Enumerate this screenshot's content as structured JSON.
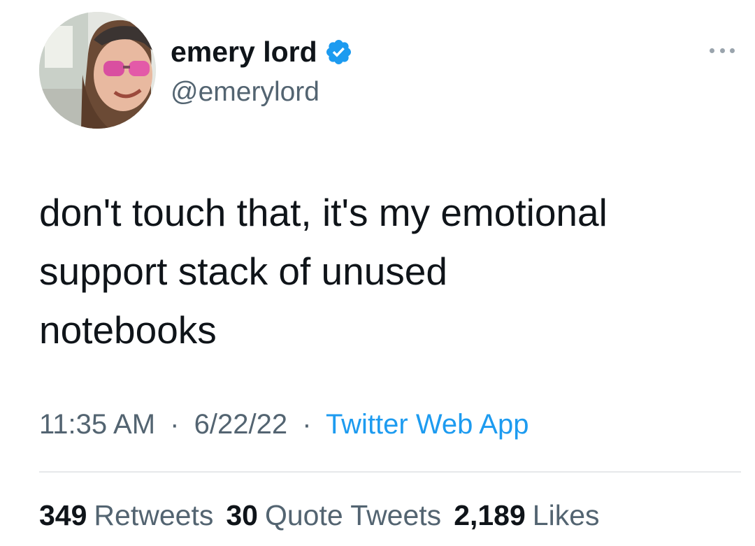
{
  "author": {
    "display_name": "emery lord",
    "handle": "@emerylord",
    "verified": true,
    "avatar_icon": "profile-photo",
    "verified_color": "#1d9bf0"
  },
  "tweet": {
    "text_lines": [
      "don't touch that, it's my emotional",
      "support stack of unused",
      "notebooks"
    ],
    "time": "11:35 AM",
    "date": "6/22/22",
    "source": "Twitter Web App",
    "separator": "·"
  },
  "stats": {
    "retweets_count": "349",
    "retweets_label": "Retweets",
    "quotes_count": "30",
    "quotes_label": "Quote Tweets",
    "likes_count": "2,189",
    "likes_label": "Likes"
  },
  "colors": {
    "link": "#1d9bf0",
    "secondary_text": "#536471",
    "primary_text": "#0f1419"
  }
}
